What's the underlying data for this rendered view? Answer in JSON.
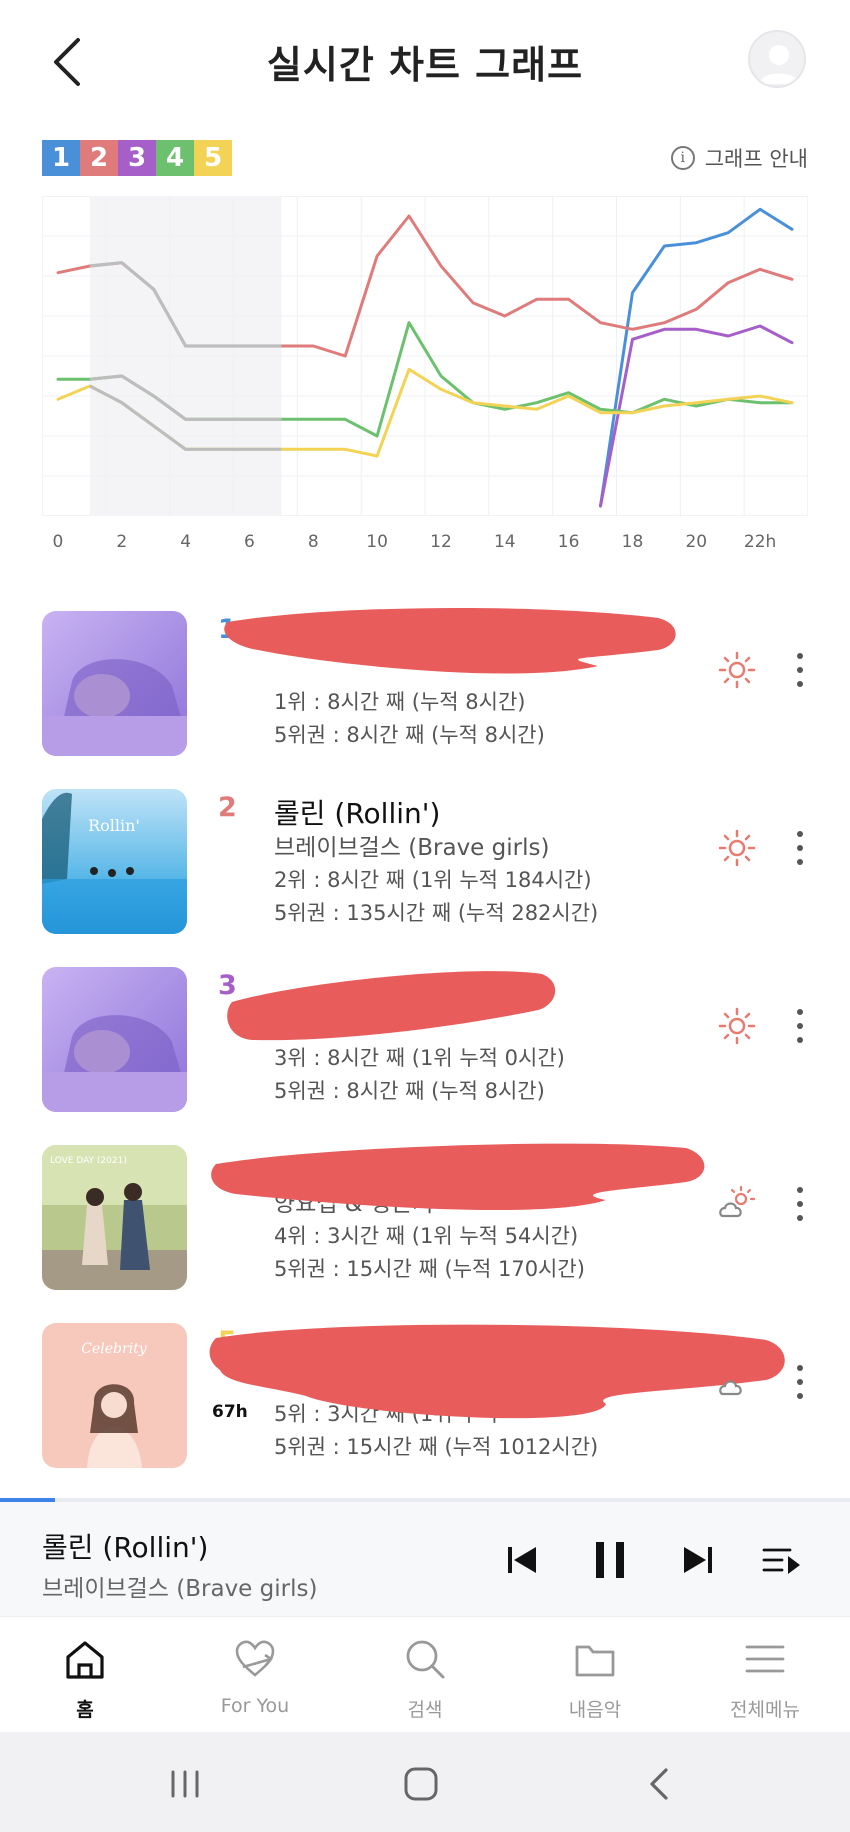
{
  "header": {
    "title": "실시간 차트 그래프"
  },
  "legend": {
    "ranks": [
      "1",
      "2",
      "3",
      "4",
      "5"
    ],
    "colors": [
      "#4a90d9",
      "#e07b7b",
      "#a65fc8",
      "#6cc06e",
      "#f3d356"
    ],
    "guide_label": "그래프 안내"
  },
  "chart_data": {
    "type": "line",
    "x_ticks": [
      "0",
      "2",
      "4",
      "6",
      "8",
      "10",
      "12",
      "14",
      "16",
      "18",
      "20",
      "22h"
    ],
    "x": [
      0,
      1,
      2,
      3,
      4,
      5,
      6,
      7,
      8,
      9,
      10,
      11,
      12,
      13,
      14,
      15,
      16,
      17,
      18,
      19,
      20,
      21,
      22,
      23
    ],
    "y_reversed": true,
    "y_range": [
      1,
      10
    ],
    "grid": true,
    "legend": "top-left",
    "series": [
      {
        "color": "#4a90d9",
        "values": [
          null,
          null,
          null,
          null,
          null,
          null,
          null,
          null,
          null,
          null,
          null,
          null,
          null,
          null,
          null,
          null,
          null,
          10,
          3.6,
          2.2,
          2.1,
          1.8,
          1.1,
          1.7
        ]
      },
      {
        "color": "#e07b7b",
        "values": [
          3.0,
          2.8,
          2.7,
          3.5,
          5.2,
          5.2,
          5.2,
          5.2,
          5.2,
          5.5,
          2.5,
          1.3,
          2.8,
          3.9,
          4.3,
          3.8,
          3.8,
          4.5,
          4.7,
          4.5,
          4.1,
          3.3,
          2.9,
          3.2
        ]
      },
      {
        "color": "#a65fc8",
        "values": [
          null,
          null,
          null,
          null,
          null,
          null,
          null,
          null,
          null,
          null,
          null,
          null,
          null,
          null,
          null,
          null,
          null,
          10,
          5.0,
          4.7,
          4.7,
          4.9,
          4.6,
          5.1
        ]
      },
      {
        "color": "#6cc06e",
        "values": [
          6.2,
          6.2,
          6.1,
          6.7,
          7.4,
          7.4,
          7.4,
          7.4,
          7.4,
          7.4,
          7.9,
          4.5,
          6.1,
          6.9,
          7.1,
          6.9,
          6.6,
          7.1,
          7.2,
          6.8,
          7.0,
          6.8,
          6.9,
          6.9
        ]
      },
      {
        "color": "#f3d356",
        "values": [
          6.8,
          6.4,
          6.9,
          7.6,
          8.3,
          8.3,
          8.3,
          8.3,
          8.3,
          8.3,
          8.5,
          5.9,
          6.5,
          6.9,
          7.0,
          7.1,
          6.7,
          7.2,
          7.2,
          7.0,
          6.9,
          6.8,
          6.7,
          6.9
        ]
      }
    ],
    "inactive_range": [
      1,
      7
    ]
  },
  "songs": [
    {
      "rank": "1",
      "title": "",
      "artist": "",
      "stat1": "1위 : 8시간 째 (누적 8시간)",
      "stat2": "5위권 : 8시간 째 (누적 8시간)",
      "rank_color": "#4a90d9"
    },
    {
      "rank": "2",
      "title": "롤린 (Rollin')",
      "artist": "브레이브걸스 (Brave girls)",
      "stat1": "2위 : 8시간 째 (1위 누적 184시간)",
      "stat2": "5위권 : 135시간 째 (누적 282시간)",
      "rank_color": "#e07b7b",
      "cover_text": "Rollin'"
    },
    {
      "rank": "3",
      "title": "",
      "artist": "",
      "stat1": "3위 : 8시간 째 (1위 누적 0시간)",
      "stat2": "5위권 : 8시간 째 (누적 8시간)",
      "rank_color": "#a65fc8"
    },
    {
      "rank": "",
      "title": "",
      "artist": "양요섭 & 정은지",
      "stat1": "4위 : 3시간 째 (1위 누적 54시간)",
      "stat2": "5위권 : 15시간 째 (누적 170시간)",
      "rank_color": "#6cc06e",
      "cover_text": "LOVE DAY (2021)"
    },
    {
      "rank": "5",
      "title": "",
      "artist": "",
      "stat1": "5위 : 3시간 째 (1위 누적",
      "stat2": "5위권 : 15시간 째 (누적 1012시간)",
      "rank_color": "#f3d356",
      "note": "67h",
      "cover_text": "Celebrity"
    }
  ],
  "player": {
    "title": "롤린 (Rollin')",
    "artist": "브레이브걸스 (Brave girls)",
    "progress": 0.065
  },
  "nav": [
    {
      "label": "홈",
      "icon": "home-icon",
      "active": true
    },
    {
      "label": "For You",
      "icon": "heart-arrow-icon",
      "active": false
    },
    {
      "label": "검색",
      "icon": "search-icon",
      "active": false
    },
    {
      "label": "내음악",
      "icon": "folder-icon",
      "active": false
    },
    {
      "label": "전체메뉴",
      "icon": "menu-icon",
      "active": false
    }
  ]
}
